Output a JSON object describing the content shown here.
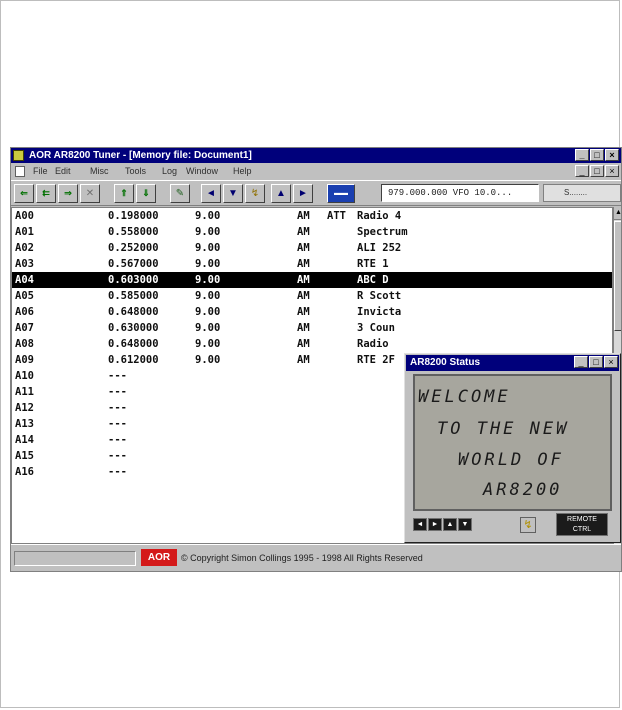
{
  "window": {
    "title": "AOR AR8200 Tuner - [Memory file: Document1]",
    "min_glyph": "_",
    "max_glyph": "□",
    "close_glyph": "×"
  },
  "menu": [
    {
      "label": "File"
    },
    {
      "label": "Edit"
    },
    {
      "label": "Misc"
    },
    {
      "label": "Tools"
    },
    {
      "label": "Log"
    },
    {
      "label": "Window"
    },
    {
      "label": "Help"
    }
  ],
  "toolbar": {
    "frequency_readout": "979.000.000 VFO 10.0...",
    "right_combo": "S........",
    "arrows": [
      "◄",
      "▼",
      "↯",
      "▲",
      "►"
    ]
  },
  "memory_list": {
    "rows": [
      {
        "channel": "A00",
        "freq": "0.198000",
        "step": "9.00",
        "mode": "AM",
        "att": "ATT",
        "name": "Radio 4",
        "selected": false
      },
      {
        "channel": "A01",
        "freq": "0.558000",
        "step": "9.00",
        "mode": "AM",
        "att": "",
        "name": "Spectrum",
        "selected": false
      },
      {
        "channel": "A02",
        "freq": "0.252000",
        "step": "9.00",
        "mode": "AM",
        "att": "",
        "name": "ALI 252",
        "selected": false
      },
      {
        "channel": "A03",
        "freq": "0.567000",
        "step": "9.00",
        "mode": "AM",
        "att": "",
        "name": "RTE 1",
        "selected": false
      },
      {
        "channel": "A04",
        "freq": "0.603000",
        "step": "9.00",
        "mode": "AM",
        "att": "",
        "name": "ABC D",
        "selected": true
      },
      {
        "channel": "A05",
        "freq": "0.585000",
        "step": "9.00",
        "mode": "AM",
        "att": "",
        "name": "R Scott",
        "selected": false
      },
      {
        "channel": "A06",
        "freq": "0.648000",
        "step": "9.00",
        "mode": "AM",
        "att": "",
        "name": "Invicta",
        "selected": false
      },
      {
        "channel": "A07",
        "freq": "0.630000",
        "step": "9.00",
        "mode": "AM",
        "att": "",
        "name": "3 Coun",
        "selected": false
      },
      {
        "channel": "A08",
        "freq": "0.648000",
        "step": "9.00",
        "mode": "AM",
        "att": "",
        "name": "Radio",
        "selected": false
      },
      {
        "channel": "A09",
        "freq": "0.612000",
        "step": "9.00",
        "mode": "AM",
        "att": "",
        "name": "RTE 2F",
        "selected": false
      },
      {
        "channel": "A10",
        "freq": "---",
        "step": "",
        "mode": "",
        "att": "",
        "name": "",
        "selected": false
      },
      {
        "channel": "A11",
        "freq": "---",
        "step": "",
        "mode": "",
        "att": "",
        "name": "",
        "selected": false
      },
      {
        "channel": "A12",
        "freq": "---",
        "step": "",
        "mode": "",
        "att": "",
        "name": "",
        "selected": false
      },
      {
        "channel": "A13",
        "freq": "---",
        "step": "",
        "mode": "",
        "att": "",
        "name": "",
        "selected": false
      },
      {
        "channel": "A14",
        "freq": "---",
        "step": "",
        "mode": "",
        "att": "",
        "name": "",
        "selected": false
      },
      {
        "channel": "A15",
        "freq": "---",
        "step": "",
        "mode": "",
        "att": "",
        "name": "",
        "selected": false
      },
      {
        "channel": "A16",
        "freq": "---",
        "step": "",
        "mode": "",
        "att": "",
        "name": "",
        "selected": false
      }
    ]
  },
  "status_window": {
    "title": "AR8200 Status",
    "lcd_lines": [
      "WELCOME",
      "TO THE NEW",
      "WORLD OF",
      "AR8200"
    ],
    "remote_label": "REMOTE\nCTRL"
  },
  "statusbar": {
    "logo": "AOR",
    "copyright": "© Copyright Simon Collings 1995 - 1998 All Rights Reserved"
  },
  "colors": {
    "titlebar": "#00007b",
    "selection": "#000000",
    "lcd_background": "#a7a69e",
    "logo_red": "#d41a1a"
  }
}
